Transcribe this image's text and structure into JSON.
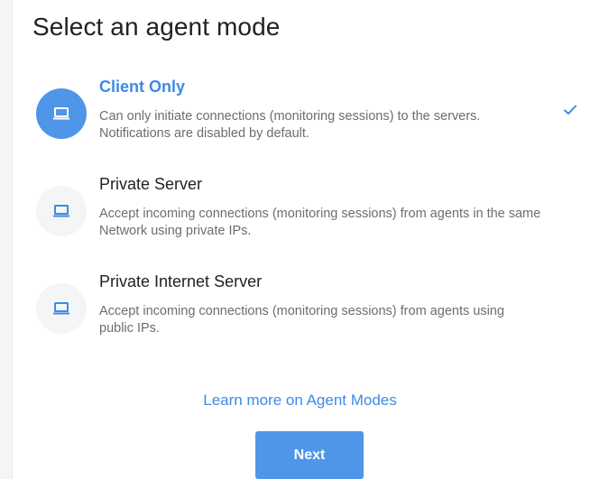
{
  "page": {
    "title": "Select an agent mode"
  },
  "modes": [
    {
      "name": "Client Only",
      "description": "Can only initiate connections (monitoring sessions) to the servers. Notifications are disabled by default.",
      "selected": true,
      "icon": "laptop-icon"
    },
    {
      "name": "Private Server",
      "description": "Accept incoming connections (monitoring sessions) from agents in the same Network using private IPs.",
      "selected": false,
      "icon": "laptop-icon"
    },
    {
      "name": "Private Internet Server",
      "description": "Accept incoming connections (monitoring sessions) from agents using public IPs.",
      "selected": false,
      "icon": "laptop-icon"
    }
  ],
  "links": {
    "learn_more": "Learn more on Agent Modes"
  },
  "actions": {
    "next_label": "Next"
  },
  "colors": {
    "accent": "#4f96e8",
    "accent_text": "#3d8ae6",
    "icon_bg": "#f3f5f7",
    "description_text": "#6d6d6d"
  }
}
